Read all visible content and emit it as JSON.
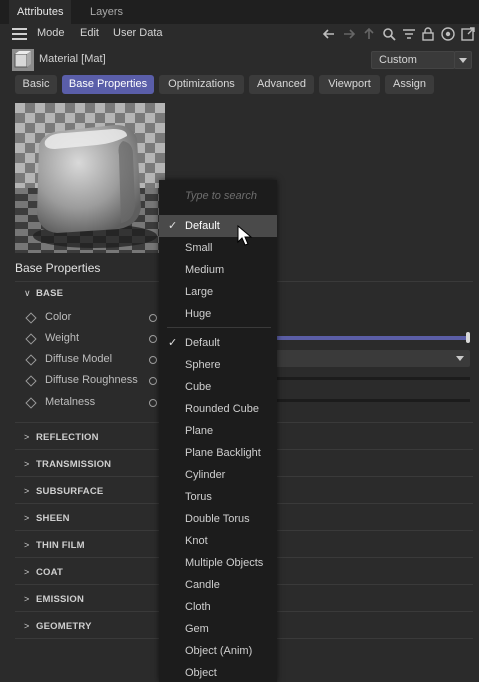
{
  "tabs": [
    "Attributes",
    "Layers"
  ],
  "menu": [
    "Mode",
    "Edit",
    "User Data"
  ],
  "material": {
    "name": "Material [Mat]",
    "preset": "Custom"
  },
  "prop_tabs": [
    "Basic",
    "Base Properties",
    "Optimizations",
    "Advanced",
    "Viewport",
    "Assign"
  ],
  "active_tab": "Base Properties",
  "section_title": "Base Properties",
  "base_group": "BASE",
  "params": [
    "Color",
    "Weight",
    "Diffuse Model",
    "Diffuse Roughness",
    "Metalness"
  ],
  "groups": [
    "REFLECTION",
    "TRANSMISSION",
    "SUBSURFACE",
    "SHEEN",
    "THIN FILM",
    "COAT",
    "EMISSION",
    "GEOMETRY"
  ],
  "popup": {
    "search_placeholder": "Type to search",
    "sizes": [
      "Default",
      "Small",
      "Medium",
      "Large",
      "Huge"
    ],
    "objects": [
      "Default",
      "Sphere",
      "Cube",
      "Rounded Cube",
      "Plane",
      "Plane Backlight",
      "Cylinder",
      "Torus",
      "Double Torus",
      "Knot",
      "Multiple Objects",
      "Candle",
      "Cloth",
      "Gem",
      "Object (Anim)",
      "Object"
    ],
    "checked_size": "Default",
    "checked_object": "Default",
    "hover_item": "Default"
  },
  "colors": {
    "accent": "#5a5ea9",
    "slider": "#5b5ea6"
  }
}
